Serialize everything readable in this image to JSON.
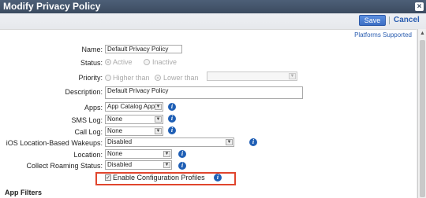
{
  "window": {
    "title": "Modify Privacy Policy",
    "close_glyph": "×"
  },
  "toolbar": {
    "save_label": "Save",
    "cancel_label": "Cancel"
  },
  "platforms_link": "Platforms Supported",
  "fields": {
    "name": {
      "label": "Name:",
      "value": "Default Privacy Policy"
    },
    "status": {
      "label": "Status:",
      "options": [
        "Active",
        "Inactive"
      ],
      "selected": "Active"
    },
    "priority": {
      "label": "Priority:",
      "options": [
        "Higher than",
        "Lower than"
      ],
      "selected": "Lower than",
      "select_value": ""
    },
    "description": {
      "label": "Description:",
      "value": "Default Privacy Policy"
    },
    "apps": {
      "label": "Apps:",
      "value": "App Catalog Apps"
    },
    "sms_log": {
      "label": "SMS Log:",
      "value": "None"
    },
    "call_log": {
      "label": "Call Log:",
      "value": "None"
    },
    "ios_wakeups": {
      "label": "iOS Location-Based Wakeups:",
      "value": "Disabled"
    },
    "location": {
      "label": "Location:",
      "value": "None"
    },
    "roaming": {
      "label": "Collect Roaming Status:",
      "value": "Disabled"
    },
    "config_profiles": {
      "label": "Enable Configuration Profiles",
      "checked": true
    }
  },
  "sections": {
    "app_filters": "App Filters"
  },
  "icons": {
    "info": "info-icon",
    "dropdown": "chevron-down-icon",
    "close": "close-icon",
    "check": "checkmark-icon"
  },
  "colors": {
    "accent": "#1f5fb5",
    "highlight": "#e0452d",
    "titlebar": "#3b4b60"
  }
}
